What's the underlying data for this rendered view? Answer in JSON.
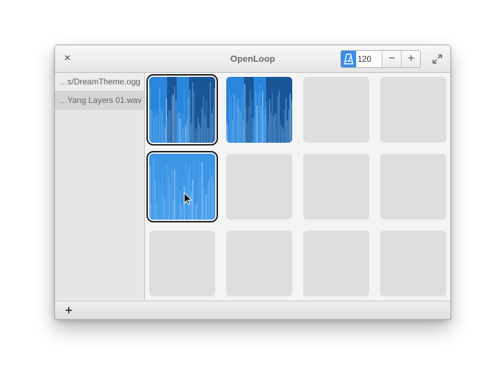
{
  "window": {
    "title": "OpenLoop",
    "close_label": "×",
    "tempo": {
      "value": "120",
      "minus_label": "−",
      "plus_label": "+"
    }
  },
  "sidebar": {
    "items": [
      {
        "label": "…s/DreamTheme.ogg"
      },
      {
        "label": "…Yang Layers 01.wav"
      }
    ]
  },
  "pads": [
    {
      "state": "loaded",
      "selected": true,
      "palette": "dark"
    },
    {
      "state": "loaded",
      "selected": false,
      "palette": "dark"
    },
    {
      "state": "empty"
    },
    {
      "state": "empty"
    },
    {
      "state": "loaded",
      "selected": true,
      "palette": "light"
    },
    {
      "state": "empty"
    },
    {
      "state": "empty"
    },
    {
      "state": "empty"
    },
    {
      "state": "empty"
    },
    {
      "state": "empty"
    },
    {
      "state": "empty"
    },
    {
      "state": "empty"
    }
  ],
  "bottombar": {
    "add_label": "+"
  },
  "colors": {
    "accent": "#3b8ee3",
    "pad_blue": "#2b7fd6",
    "pad_dark": "#1c5a9e",
    "pad_empty": "#dedede"
  }
}
